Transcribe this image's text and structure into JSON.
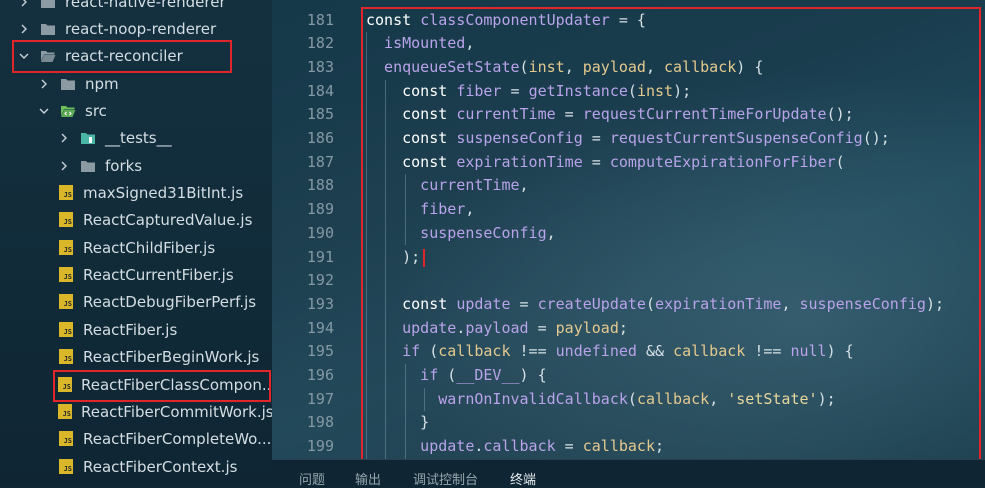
{
  "sidebar": {
    "items": [
      {
        "label": "react-native-renderer",
        "kind": "folder",
        "expanded": false
      },
      {
        "label": "react-noop-renderer",
        "kind": "folder",
        "expanded": false
      },
      {
        "label": "react-reconciler",
        "kind": "folder",
        "expanded": true
      },
      {
        "label": "npm",
        "kind": "folder",
        "expanded": false
      },
      {
        "label": "src",
        "kind": "src-folder",
        "expanded": true
      },
      {
        "label": "__tests__",
        "kind": "test-folder",
        "expanded": false
      },
      {
        "label": "forks",
        "kind": "folder",
        "expanded": false
      },
      {
        "label": "maxSigned31BitInt.js",
        "kind": "js"
      },
      {
        "label": "ReactCapturedValue.js",
        "kind": "js"
      },
      {
        "label": "ReactChildFiber.js",
        "kind": "js"
      },
      {
        "label": "ReactCurrentFiber.js",
        "kind": "js"
      },
      {
        "label": "ReactDebugFiberPerf.js",
        "kind": "js"
      },
      {
        "label": "ReactFiber.js",
        "kind": "js"
      },
      {
        "label": "ReactFiberBeginWork.js",
        "kind": "js"
      },
      {
        "label": "ReactFiberClassCompon...",
        "kind": "js",
        "selected": true
      },
      {
        "label": "ReactFiberCommitWork.js",
        "kind": "js"
      },
      {
        "label": "ReactFiberCompleteWo...",
        "kind": "js"
      },
      {
        "label": "ReactFiberContext.js",
        "kind": "js"
      }
    ],
    "js_badge": "JS"
  },
  "editor": {
    "line_numbers": [
      "181",
      "182",
      "183",
      "184",
      "185",
      "186",
      "187",
      "188",
      "189",
      "190",
      "191",
      "192",
      "193",
      "194",
      "195",
      "196",
      "197",
      "198",
      "199"
    ],
    "lines": [
      [
        [
          "k",
          "const "
        ],
        [
          "v",
          "classComponentUpdater"
        ],
        [
          "d",
          " = {"
        ]
      ],
      [
        [
          "v",
          "  isMounted"
        ],
        [
          "d",
          ","
        ]
      ],
      [
        [
          "v",
          "  enqueueSetState"
        ],
        [
          "d",
          "("
        ],
        [
          "p",
          "inst"
        ],
        [
          "d",
          ", "
        ],
        [
          "p",
          "payload"
        ],
        [
          "d",
          ", "
        ],
        [
          "p",
          "callback"
        ],
        [
          "d",
          ") {"
        ]
      ],
      [
        [
          "k",
          "    const "
        ],
        [
          "v",
          "fiber"
        ],
        [
          "d",
          " = "
        ],
        [
          "v",
          "getInstance"
        ],
        [
          "d",
          "("
        ],
        [
          "p",
          "inst"
        ],
        [
          "d",
          ");"
        ]
      ],
      [
        [
          "k",
          "    const "
        ],
        [
          "v",
          "currentTime"
        ],
        [
          "d",
          " = "
        ],
        [
          "v",
          "requestCurrentTimeForUpdate"
        ],
        [
          "d",
          "();"
        ]
      ],
      [
        [
          "k",
          "    const "
        ],
        [
          "v",
          "suspenseConfig"
        ],
        [
          "d",
          " = "
        ],
        [
          "v",
          "requestCurrentSuspenseConfig"
        ],
        [
          "d",
          "();"
        ]
      ],
      [
        [
          "k",
          "    const "
        ],
        [
          "v",
          "expirationTime"
        ],
        [
          "d",
          " = "
        ],
        [
          "v",
          "computeExpirationForFiber"
        ],
        [
          "d",
          "("
        ]
      ],
      [
        [
          "v",
          "      currentTime"
        ],
        [
          "d",
          ","
        ]
      ],
      [
        [
          "v",
          "      fiber"
        ],
        [
          "d",
          ","
        ]
      ],
      [
        [
          "v",
          "      suspenseConfig"
        ],
        [
          "d",
          ","
        ]
      ],
      [
        [
          "d",
          "    );"
        ]
      ],
      [],
      [
        [
          "k",
          "    const "
        ],
        [
          "v",
          "update"
        ],
        [
          "d",
          " = "
        ],
        [
          "v",
          "createUpdate"
        ],
        [
          "d",
          "("
        ],
        [
          "v",
          "expirationTime"
        ],
        [
          "d",
          ", "
        ],
        [
          "v",
          "suspenseConfig"
        ],
        [
          "d",
          ");"
        ]
      ],
      [
        [
          "v",
          "    update"
        ],
        [
          "d",
          "."
        ],
        [
          "v",
          "payload"
        ],
        [
          "d",
          " = "
        ],
        [
          "p",
          "payload"
        ],
        [
          "d",
          ";"
        ]
      ],
      [
        [
          "v",
          "    if"
        ],
        [
          "d",
          " ("
        ],
        [
          "p",
          "callback"
        ],
        [
          "d",
          " !== "
        ],
        [
          "v",
          "undefined"
        ],
        [
          "d",
          " && "
        ],
        [
          "p",
          "callback"
        ],
        [
          "d",
          " !== "
        ],
        [
          "v",
          "null"
        ],
        [
          "d",
          ") {"
        ]
      ],
      [
        [
          "v",
          "      if"
        ],
        [
          "d",
          " ("
        ],
        [
          "v",
          "__DEV__"
        ],
        [
          "d",
          ") {"
        ]
      ],
      [
        [
          "v",
          "        warnOnInvalidCallback"
        ],
        [
          "d",
          "("
        ],
        [
          "p",
          "callback"
        ],
        [
          "d",
          ", "
        ],
        [
          "s",
          "'setState'"
        ],
        [
          "d",
          ");"
        ]
      ],
      [
        [
          "d",
          "      }"
        ]
      ],
      [
        [
          "v",
          "      update"
        ],
        [
          "d",
          "."
        ],
        [
          "v",
          "callback"
        ],
        [
          "d",
          " = "
        ],
        [
          "p",
          "callback"
        ],
        [
          "d",
          ";"
        ]
      ]
    ]
  },
  "panel": {
    "tabs": [
      {
        "label": "问题"
      },
      {
        "label": "输出"
      },
      {
        "label": "调试控制台"
      },
      {
        "label": "终端",
        "active": true
      }
    ]
  },
  "colors": {
    "highlight": "#e0252b",
    "js_badge": "#d9b728",
    "folder": "#8c9aa3",
    "src_folder": "#6cbf5a",
    "test_folder": "#49b6a6"
  }
}
